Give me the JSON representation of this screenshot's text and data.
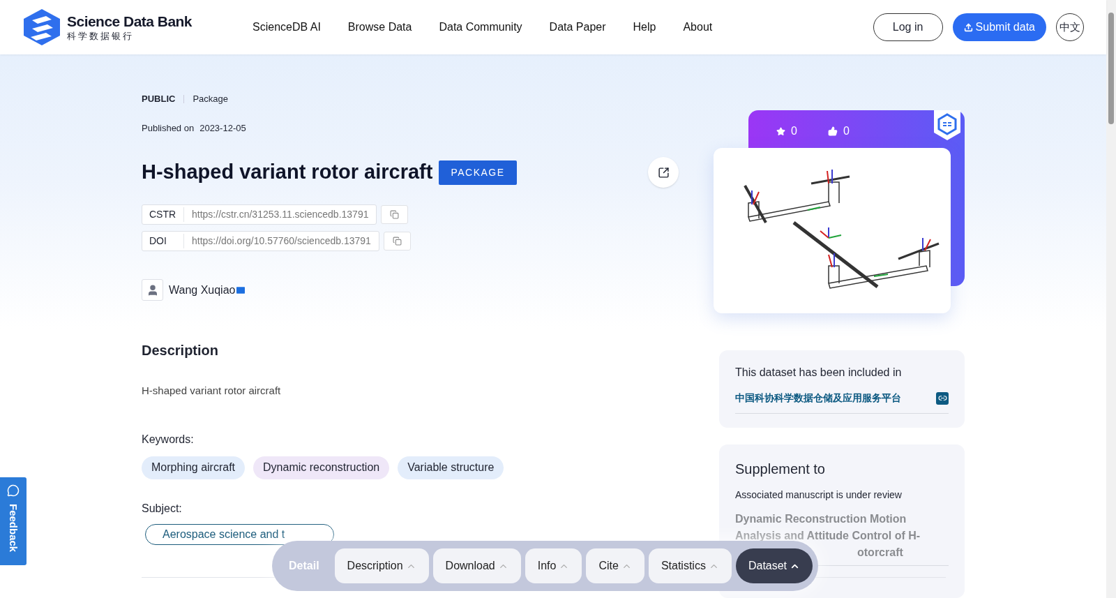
{
  "header": {
    "logo": {
      "name": "Science Data Bank",
      "subtitle": "科学数据银行"
    },
    "nav": [
      {
        "label": "ScienceDB AI"
      },
      {
        "label": "Browse Data"
      },
      {
        "label": "Data Community"
      },
      {
        "label": "Data Paper"
      },
      {
        "label": "Help"
      },
      {
        "label": "About"
      }
    ],
    "login": "Log in",
    "submit": "Submit data",
    "language": "中文"
  },
  "dataset": {
    "access": "PUBLIC",
    "type": "Package",
    "published_label": "Published on",
    "published_date": "2023-12-05",
    "title": "H-shaped variant rotor aircraft",
    "badge": "PACKAGE",
    "identifiers": [
      {
        "label": "CSTR",
        "value": "https://cstr.cn/31253.11.sciencedb.13791"
      },
      {
        "label": "DOI",
        "value": "https://doi.org/10.57760/sciencedb.13791"
      }
    ],
    "author": {
      "name": "Wang Xuqiao"
    },
    "description": {
      "heading": "Description",
      "text": "H-shaped variant rotor aircraft"
    },
    "keywords": {
      "label": "Keywords:",
      "items": [
        {
          "text": "Morphing aircraft",
          "color": "#e3edfb"
        },
        {
          "text": "Dynamic reconstruction",
          "color": "#efe7f8"
        },
        {
          "text": "Variable structure",
          "color": "#e3edfb"
        }
      ]
    },
    "subject": {
      "label": "Subject:",
      "items": [
        {
          "text": "Aerospace science and t"
        }
      ]
    }
  },
  "sidebar": {
    "stars": "0",
    "likes": "0",
    "inclusion": {
      "text": "This dataset has been included in",
      "link": "中国科协科学数据仓储及应用服务平台"
    },
    "supplement": {
      "heading": "Supplement to",
      "note": "Associated manuscript is under review",
      "title_visible": "Dynamic Reconstruction Motion Analysis and Attitude Control of H-",
      "title_tail": "otorcraft"
    }
  },
  "detail_bar": {
    "label": "Detail",
    "items": [
      {
        "label": "Description",
        "selected": false
      },
      {
        "label": "Download",
        "selected": false
      },
      {
        "label": "Info",
        "selected": false
      },
      {
        "label": "Cite",
        "selected": false
      },
      {
        "label": "Statistics",
        "selected": false
      },
      {
        "label": "Dataset",
        "selected": true
      }
    ]
  },
  "feedback": "Feedback"
}
